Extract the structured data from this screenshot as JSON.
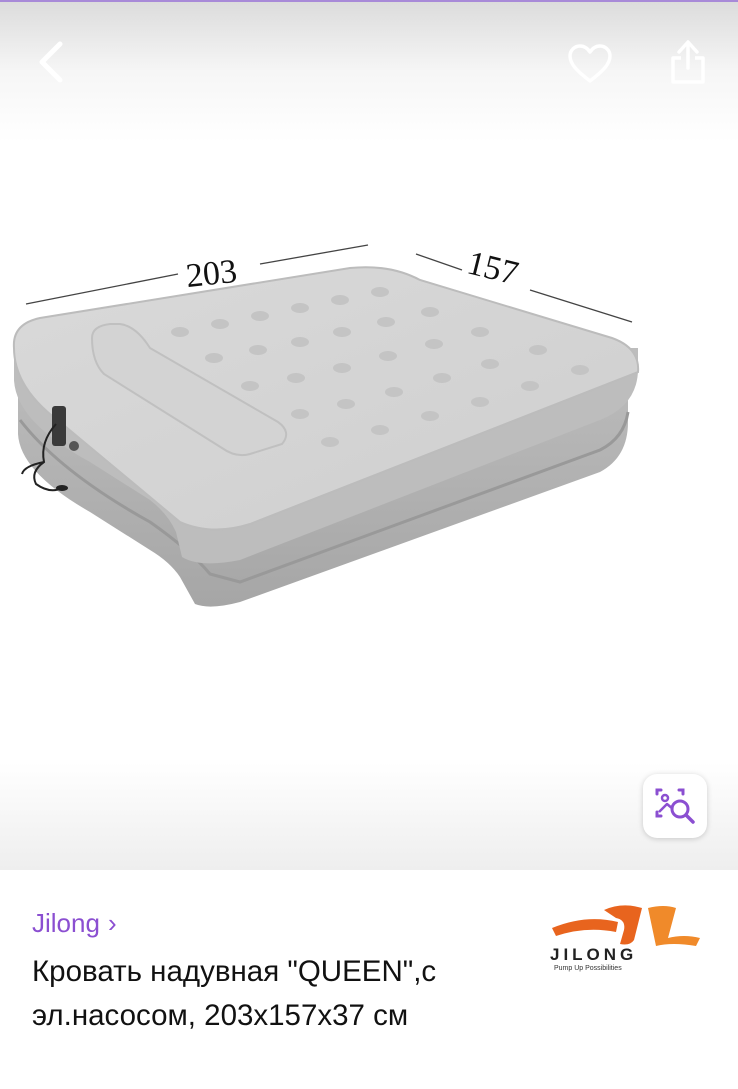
{
  "image": {
    "dimension_length": "203",
    "dimension_width": "157"
  },
  "header": {
    "back_icon": "chevron-left-icon",
    "favorite_icon": "heart-outline-icon",
    "share_icon": "share-icon"
  },
  "visual_search": {
    "icon": "image-search-icon"
  },
  "product": {
    "brand": "Jilong",
    "brand_chevron": "›",
    "title": "Кровать надувная \"QUEEN\",с эл.насосом, 203х157х37 см"
  },
  "logo": {
    "wordmark": "JILONG",
    "tagline": "Pump Up Possibilities"
  },
  "colors": {
    "accent": "#8b4fd1",
    "mattress": "#c9c9c9",
    "logo_orange": "#e8641e"
  }
}
